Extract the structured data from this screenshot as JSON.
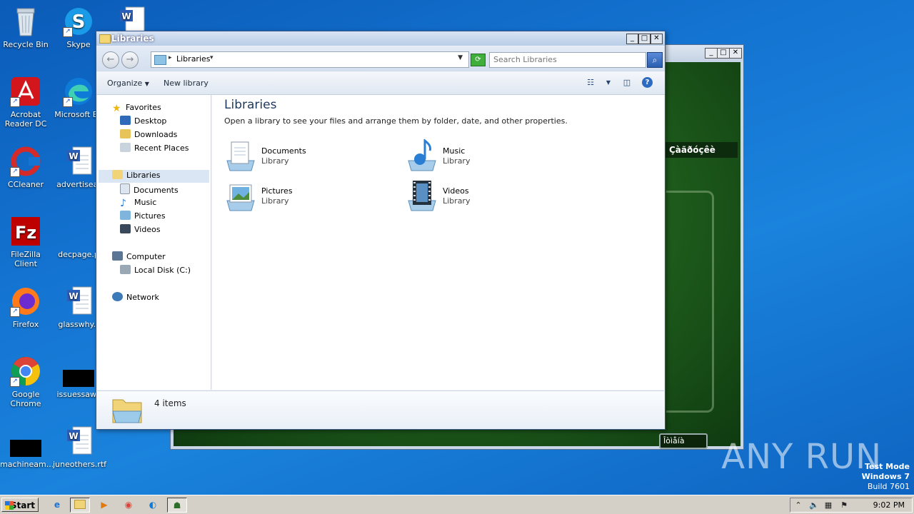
{
  "desktop": {
    "icons": [
      {
        "label": "Recycle Bin"
      },
      {
        "label": "Skype"
      },
      {
        "label": "Acrobat Reader DC"
      },
      {
        "label": "Microsoft Ed"
      },
      {
        "label": "CCleaner"
      },
      {
        "label": "advertisea."
      },
      {
        "label": "FileZilla Client"
      },
      {
        "label": "decpage.p"
      },
      {
        "label": "Firefox"
      },
      {
        "label": "glasswhy.r"
      },
      {
        "label": "Google Chrome"
      },
      {
        "label": "issuessaw.j"
      },
      {
        "label": "machineam..."
      },
      {
        "label": "juneothers.rtf"
      }
    ],
    "watermark": "ANY RUN",
    "test_mode": {
      "line1": "Test Mode",
      "line2": "Windows 7",
      "line3": "Build 7601"
    }
  },
  "green_window": {
    "menu_label": "Çàãðóçêè",
    "button_label": "Îòìåíà"
  },
  "explorer": {
    "title": "Libraries",
    "address": "Libraries",
    "search_placeholder": "Search Libraries",
    "toolbar": {
      "organize": "Organize",
      "new_library": "New library"
    },
    "nav": {
      "favorites": "Favorites",
      "desktop": "Desktop",
      "downloads": "Downloads",
      "recent_places": "Recent Places",
      "libraries": "Libraries",
      "documents": "Documents",
      "music": "Music",
      "pictures": "Pictures",
      "videos": "Videos",
      "computer": "Computer",
      "local_disk": "Local Disk (C:)",
      "network": "Network"
    },
    "main": {
      "heading": "Libraries",
      "subtitle": "Open a library to see your files and arrange them by folder, date, and other properties.",
      "libraries": [
        {
          "name": "Documents",
          "type": "Library"
        },
        {
          "name": "Music",
          "type": "Library"
        },
        {
          "name": "Pictures",
          "type": "Library"
        },
        {
          "name": "Videos",
          "type": "Library"
        }
      ]
    },
    "details": {
      "count": "4 items"
    }
  },
  "taskbar": {
    "start": "Start",
    "clock": "9:02 PM"
  },
  "colors": {
    "accent": "#1e395b",
    "selection": "#dbe6f4",
    "desktop": "#1474d1"
  }
}
